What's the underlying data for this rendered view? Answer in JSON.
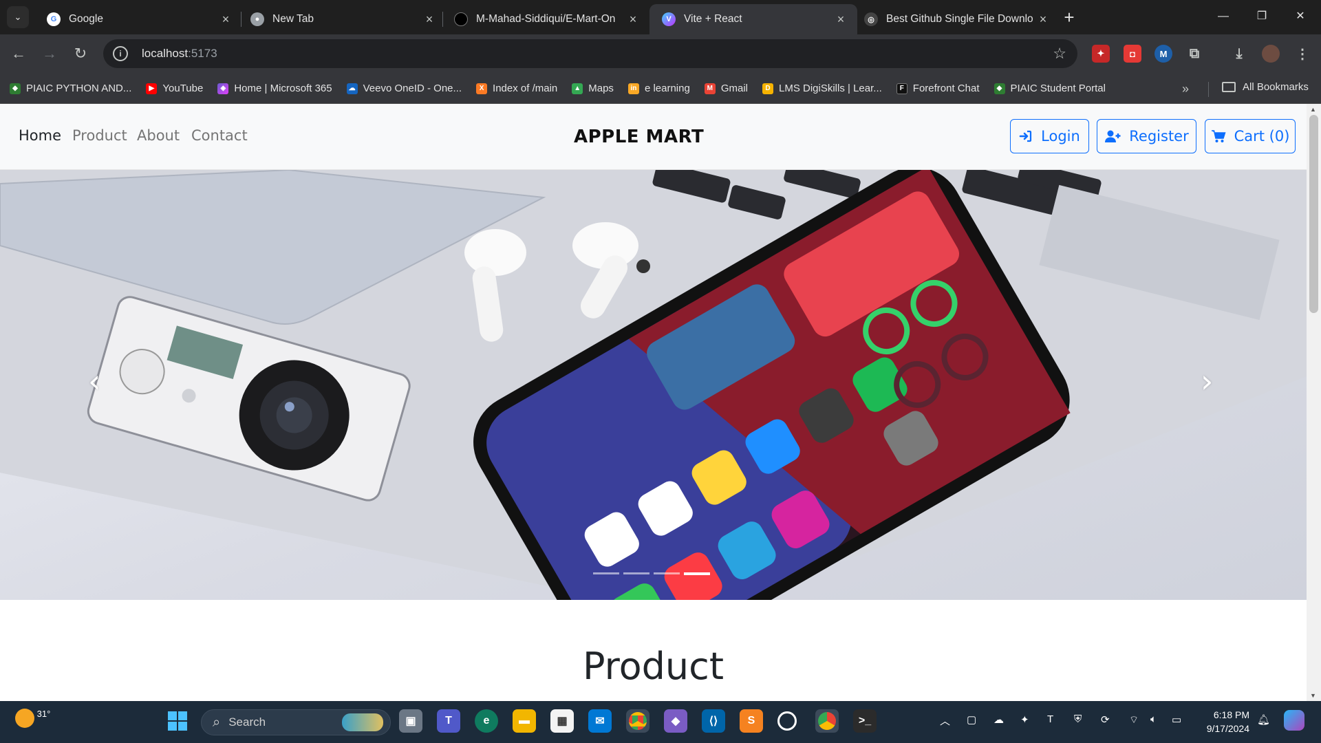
{
  "browser": {
    "tabs": [
      {
        "title": "Google",
        "favicon": "google-icon"
      },
      {
        "title": "New Tab",
        "favicon": "chrome-icon"
      },
      {
        "title": "M-Mahad-Siddiqui/E-Mart-On",
        "favicon": "github-icon"
      },
      {
        "title": "Vite + React",
        "favicon": "vite-icon",
        "active": true
      },
      {
        "title": "Best Github Single File Downlo",
        "favicon": "github-download-icon"
      }
    ],
    "url_host": "localhost",
    "url_port": ":5173",
    "bookmarks": [
      {
        "label": "PIAIC PYTHON AND...",
        "icon": "piaic-icon"
      },
      {
        "label": "YouTube",
        "icon": "youtube-icon"
      },
      {
        "label": "Home | Microsoft 365",
        "icon": "m365-icon"
      },
      {
        "label": "Veevo OneID - One...",
        "icon": "veevo-icon"
      },
      {
        "label": "Index of /main",
        "icon": "xampp-icon"
      },
      {
        "label": "Maps",
        "icon": "maps-icon"
      },
      {
        "label": "e learning",
        "icon": "elearning-icon"
      },
      {
        "label": "Gmail",
        "icon": "gmail-icon"
      },
      {
        "label": "LMS DigiSkills | Lear...",
        "icon": "digiskills-icon"
      },
      {
        "label": "Forefront Chat",
        "icon": "forefront-icon"
      },
      {
        "label": "PIAIC Student Portal",
        "icon": "piaic-icon"
      }
    ],
    "all_bookmarks_label": "All Bookmarks"
  },
  "site": {
    "nav": {
      "links": [
        "Home",
        "Product",
        "About",
        "Contact"
      ],
      "brand": "APPLE MART",
      "login_label": "Login",
      "register_label": "Register",
      "cart_label": "Cart (0)"
    },
    "carousel": {
      "slide_count": 4,
      "active_index": 3,
      "prev_label": "‹",
      "next_label": "›"
    },
    "section_title": "Product"
  },
  "taskbar": {
    "weather_temp": "31°",
    "search_placeholder": "Search",
    "time": "6:18 PM",
    "date": "9/17/2024"
  },
  "colors": {
    "accent": "#0d6efd",
    "navbar_bg": "#f8f9fa",
    "chrome_dark": "#35363a",
    "taskbar": "#1c2b3a"
  }
}
